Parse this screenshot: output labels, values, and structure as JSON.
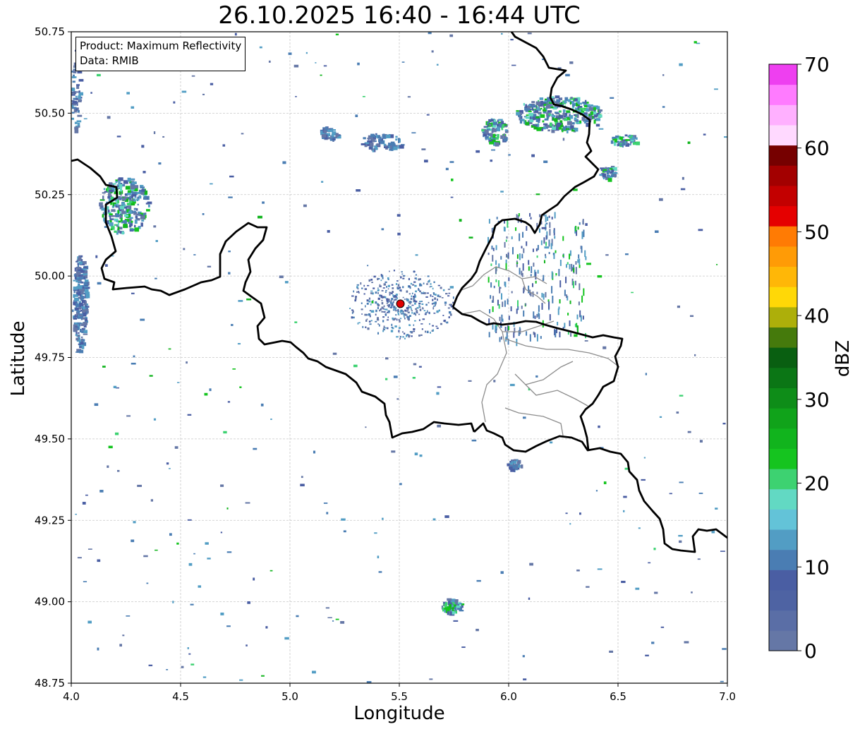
{
  "title": "26.10.2025 16:40 - 16:44 UTC",
  "info": {
    "product": "Product: Maximum Reflectivity",
    "data": "Data: RMIB"
  },
  "axes": {
    "xlabel": "Longitude",
    "ylabel": "Latitude",
    "xlim": [
      4.0,
      7.0
    ],
    "ylim": [
      48.75,
      50.75
    ],
    "xticks": [
      "4.0",
      "4.5",
      "5.0",
      "5.5",
      "6.0",
      "6.5",
      "7.0"
    ],
    "yticks": [
      "48.75",
      "49.00",
      "49.25",
      "49.50",
      "49.75",
      "50.00",
      "50.25",
      "50.50",
      "50.75"
    ],
    "grid": true
  },
  "colorbar": {
    "label": "dBZ",
    "range": [
      0,
      70
    ],
    "ticks": [
      "0",
      "10",
      "20",
      "30",
      "40",
      "50",
      "60",
      "70"
    ],
    "colors": [
      "#6577a6",
      "#5a6ea6",
      "#4e63a3",
      "#4a5ea3",
      "#4a7db3",
      "#529dc4",
      "#63c3d8",
      "#62d9c3",
      "#3dd271",
      "#15c41f",
      "#11b41d",
      "#10a31a",
      "#0e8d18",
      "#0b7615",
      "#095f11",
      "#457a0c",
      "#adaf0a",
      "#ffd807",
      "#ffb707",
      "#ff9b06",
      "#ff7b04",
      "#e50000",
      "#c30000",
      "#a30000",
      "#760000",
      "#ffd9ff",
      "#ffb0ff",
      "#ff7bff",
      "#ee3ff0"
    ]
  },
  "radar_site": {
    "lon": 5.505,
    "lat": 49.915
  },
  "colors": {
    "border": "#000000",
    "admin_lines": "#8c8c8c",
    "grid": "#c8c8c8",
    "site": "#e00000"
  }
}
